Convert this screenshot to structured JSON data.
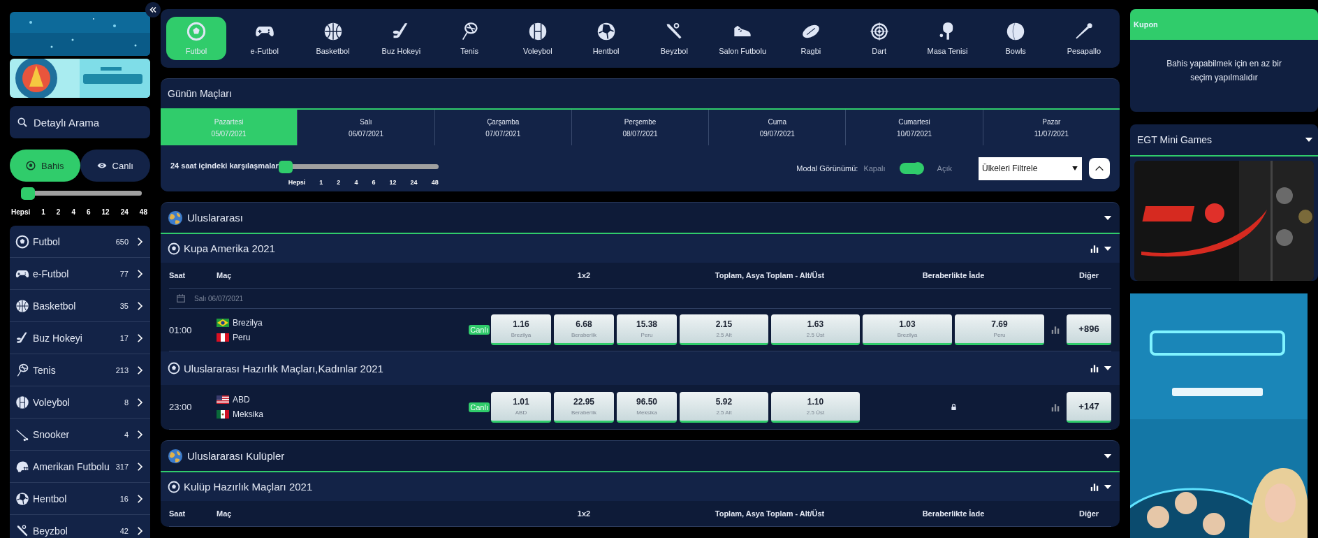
{
  "sidebar": {
    "search_button": "Detaylı Arama",
    "mode_tabs": [
      {
        "label": "Bahis",
        "selected": true
      },
      {
        "label": "Canlı",
        "selected": false
      }
    ],
    "hour_filter": {
      "level": 0,
      "labels": [
        "Hepsi",
        "1",
        "2",
        "4",
        "6",
        "12",
        "24",
        "48"
      ]
    },
    "sports": [
      {
        "name": "Futbol",
        "count": "650"
      },
      {
        "name": "e-Futbol",
        "count": "77"
      },
      {
        "name": "Basketbol",
        "count": "35"
      },
      {
        "name": "Buz Hokeyi",
        "count": "17"
      },
      {
        "name": "Tenis",
        "count": "213"
      },
      {
        "name": "Voleybol",
        "count": "8"
      },
      {
        "name": "Snooker",
        "count": "4"
      },
      {
        "name": "Amerikan Futbolu",
        "count": "317"
      },
      {
        "name": "Hentbol",
        "count": "16"
      },
      {
        "name": "Beyzbol",
        "count": "42"
      }
    ]
  },
  "sport_tabs": [
    {
      "label": "Futbol",
      "selected": true
    },
    {
      "label": "e-Futbol",
      "selected": false
    },
    {
      "label": "Basketbol",
      "selected": false
    },
    {
      "label": "Buz Hokeyi",
      "selected": false
    },
    {
      "label": "Tenis",
      "selected": false
    },
    {
      "label": "Voleybol",
      "selected": false
    },
    {
      "label": "Hentbol",
      "selected": false
    },
    {
      "label": "Beyzbol",
      "selected": false
    },
    {
      "label": "Salon Futbolu",
      "selected": false
    },
    {
      "label": "Ragbi",
      "selected": false
    },
    {
      "label": "Dart",
      "selected": false
    },
    {
      "label": "Masa Tenisi",
      "selected": false
    },
    {
      "label": "Bowls",
      "selected": false
    },
    {
      "label": "Pesapallo",
      "selected": false
    }
  ],
  "todays_matches": {
    "title": "Günün Maçları",
    "days": [
      {
        "day": "Pazartesi",
        "date": "05/07/2021",
        "selected": true
      },
      {
        "day": "Salı",
        "date": "06/07/2021",
        "selected": false
      },
      {
        "day": "Çarşamba",
        "date": "07/07/2021",
        "selected": false
      },
      {
        "day": "Perşembe",
        "date": "08/07/2021",
        "selected": false
      },
      {
        "day": "Cuma",
        "date": "09/07/2021",
        "selected": false
      },
      {
        "day": "Cumartesi",
        "date": "10/07/2021",
        "selected": false
      },
      {
        "day": "Pazar",
        "date": "11/07/2021",
        "selected": false
      }
    ],
    "hour_filter": {
      "label": "24 saat içindeki karşılaşmalar",
      "level": 0,
      "labels": [
        "Hepsi",
        "1",
        "2",
        "4",
        "6",
        "12",
        "24",
        "48"
      ]
    },
    "modal_view": {
      "label": "Modal Görünümü:",
      "off_label": "Kapalı",
      "on_label": "Açık",
      "on": true
    },
    "country_filter": {
      "value": "Ülkeleri Filtrele"
    }
  },
  "groups": [
    {
      "title": "Uluslararası",
      "leagues": [
        {
          "title": "Kupa Amerika 2021",
          "columns": [
            "Saat",
            "Maç",
            "1x2",
            "Toplam, Asya Toplam - Alt/Üst",
            "Beraberlikte İade",
            "Diğer"
          ],
          "date": "Salı 06/07/2021",
          "matches": [
            {
              "time": "01:00",
              "teams": [
                "Brezilya",
                "Peru"
              ],
              "badge": "Canlı",
              "odds": [
                {
                  "value": "1.16",
                  "label": "Brezilya"
                },
                {
                  "value": "6.68",
                  "label": "Beraberlik"
                },
                {
                  "value": "15.38",
                  "label": "Peru"
                }
              ],
              "totals": [
                {
                  "value": "2.15",
                  "label": "2.5 Alt"
                },
                {
                  "value": "1.63",
                  "label": "2.5 Üst"
                }
              ],
              "draw_no_bet_locked": false,
              "draw_no_bet": [
                {
                  "value": "1.03",
                  "label": "Brezilya"
                },
                {
                  "value": "7.69",
                  "label": "Peru"
                }
              ],
              "more": "+896"
            }
          ]
        },
        {
          "title": "Uluslararası Hazırlık Maçları,Kadınlar 2021",
          "matches": [
            {
              "time": "23:00",
              "teams": [
                "ABD",
                "Meksika"
              ],
              "badge": "Canlı",
              "odds": [
                {
                  "value": "1.01",
                  "label": "ABD"
                },
                {
                  "value": "22.95",
                  "label": "Beraberlik"
                },
                {
                  "value": "96.50",
                  "label": "Meksika"
                }
              ],
              "totals": [
                {
                  "value": "5.92",
                  "label": "2.5 Alt"
                },
                {
                  "value": "1.10",
                  "label": "2.5 Üst"
                }
              ],
              "draw_no_bet_locked": true,
              "more": "+147"
            }
          ]
        }
      ]
    },
    {
      "title": "Uluslararası Kulüpler",
      "leagues": [
        {
          "title": "Kulüp Hazırlık Maçları 2021",
          "columns": [
            "Saat",
            "Maç",
            "1x2",
            "Toplam, Asya Toplam - Alt/Üst",
            "Beraberlikte İade",
            "Diğer"
          ]
        }
      ]
    }
  ],
  "coupon": {
    "title": "Kupon",
    "message": "Bahis yapabilmek için en az bir seçim yapılmalıdır"
  },
  "mini_games": {
    "title": "EGT Mini Games"
  }
}
